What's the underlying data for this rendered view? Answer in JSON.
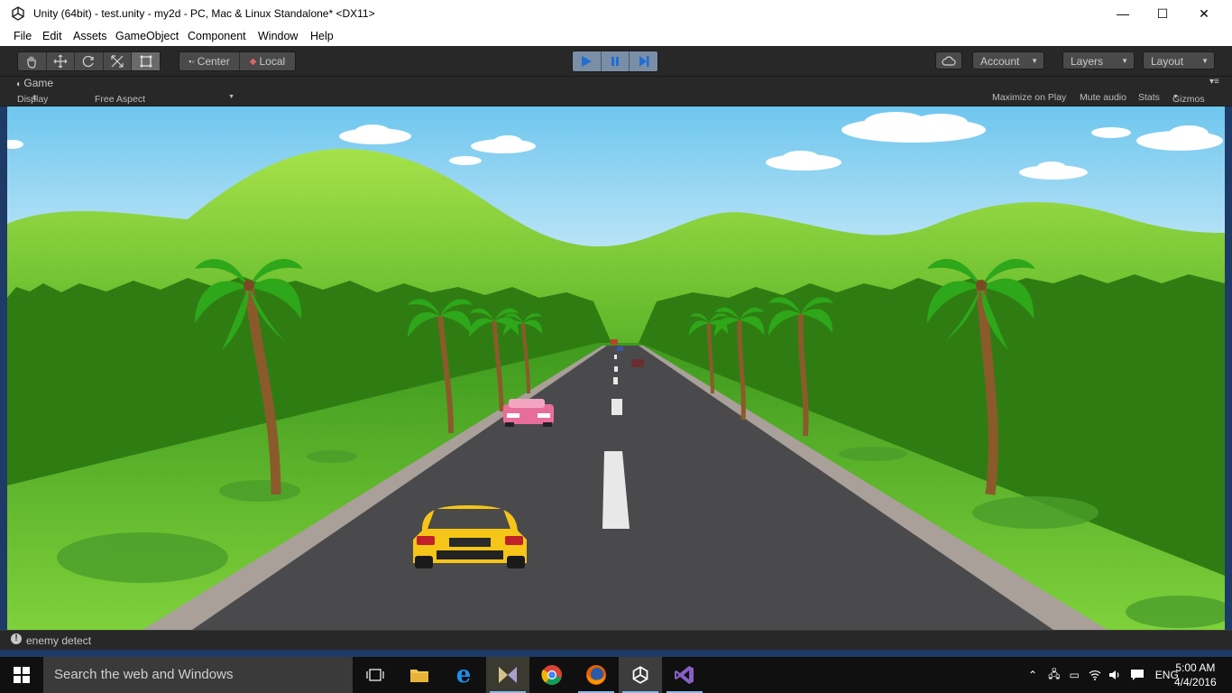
{
  "window": {
    "title": "Unity (64bit) - test.unity - my2d - PC, Mac & Linux Standalone* <DX11>",
    "minimize": "—",
    "maximize": "☐",
    "close": "✕"
  },
  "menu": [
    "File",
    "Edit",
    "Assets",
    "GameObject",
    "Component",
    "Window",
    "Help"
  ],
  "toolbar": {
    "tools": [
      "hand-icon",
      "move-icon",
      "rotate-icon",
      "scale-icon",
      "rect-icon"
    ],
    "pivot": "Center",
    "space": "Local",
    "account": "Account",
    "layers": "Layers",
    "layout": "Layout"
  },
  "game_tab": {
    "label": "Game",
    "display": "Display 1",
    "aspect": "Free Aspect",
    "maximize_on_play": "Maximize on Play",
    "mute_audio": "Mute audio",
    "stats": "Stats",
    "gizmos": "Gizmos"
  },
  "status": {
    "message": "enemy detect"
  },
  "taskbar": {
    "search_placeholder": "Search the web and Windows",
    "time": "5:00 AM",
    "date": "4/4/2016",
    "language": "ENG"
  },
  "colors": {
    "play_active": "#7a8ea6",
    "sky_top": "#6ec6ee",
    "grass": "#5fbf3a",
    "road": "#4a4a4c",
    "car_yellow": "#f5c518"
  }
}
